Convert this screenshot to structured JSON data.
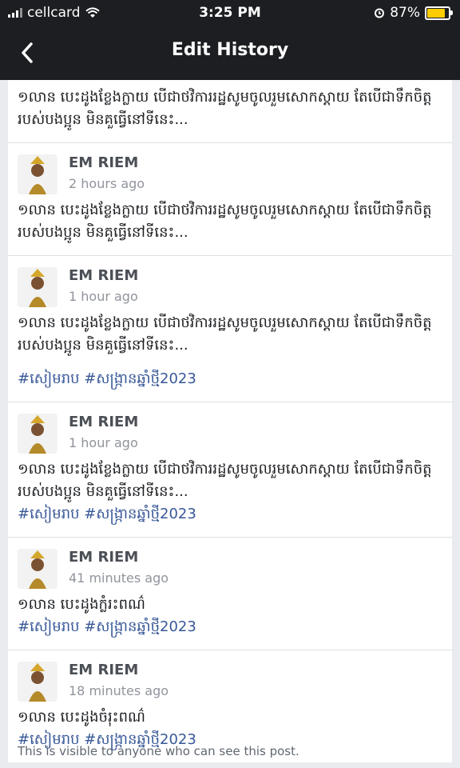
{
  "status_bar": {
    "carrier": "cellcard",
    "time": "3:25 PM",
    "battery": "87%",
    "icons": [
      "signal-icon",
      "wifi-icon",
      "alarm-icon",
      "battery-icon"
    ]
  },
  "header": {
    "title": "Edit History",
    "back_icon": "chevron-left-icon"
  },
  "colors": {
    "header_bg": "#1c1e21",
    "page_bg": "#e9ebee",
    "hashtag": "#385898",
    "name": "#4b4f56",
    "meta": "#90949c",
    "battery": "#ffcc00"
  },
  "entries": [
    {
      "text": "១លាន បេះដូងខ្លែងក្លាយ បើជាថវិការរដ្ឋសូមចូលរួមសោកស្តាយ តែបើជាទឹកចិត្តរបស់បងប្អូន មិនគួធ្វើនៅទីនេះ..."
    },
    {
      "name": "EM RIEM",
      "time": "2 hours ago",
      "text": "១លាន បេះដូងខ្លែងក្លាយ បើជាថវិការរដ្ឋសូមចូលរួមសោកស្តាយ តែបើជាទឹកចិត្តរបស់បងប្អូន មិនគួធ្វើនៅទីនេះ..."
    },
    {
      "name": "EM RIEM",
      "time": "1 hour ago",
      "text": "១លាន បេះដូងខ្លែងក្លាយ បើជាថវិការរដ្ឋសូមចូលរួមសោកស្តាយ តែបើជាទឹកចិត្តរបស់បងប្អូន មិនគួធ្វើនៅទីនេះ...",
      "tags": "#សៀមរាប #សង្ក្រានឆ្នាំថ្មី2023"
    },
    {
      "name": "EM RIEM",
      "time": "1 hour ago",
      "text": "១លាន បេះដូងខ្លែងក្លាយ បើជាថវិការរដ្ឋសូមចូលរួមសោកស្តាយ តែបើជាទឹកចិត្តរបស់បងប្អូន មិនគួធ្វើនៅទីនេះ...",
      "tags": "#សៀមរាប #សង្ក្រានឆ្នាំថ្មី2023"
    },
    {
      "name": "EM RIEM",
      "time": "41 minutes ago",
      "text": "១លាន បេះដូងក្លំរះពណ៌",
      "tags": "#សៀមរាប #សង្ក្រានឆ្នាំថ្មី2023"
    },
    {
      "name": "EM RIEM",
      "time": "18 minutes ago",
      "text": "១លាន បេះដូងចំរុះពណ៌",
      "tags": "#សៀមរាប #សង្ក្រានឆ្នាំថ្មី2023"
    }
  ],
  "footer": "This is visible to anyone who can see this post."
}
